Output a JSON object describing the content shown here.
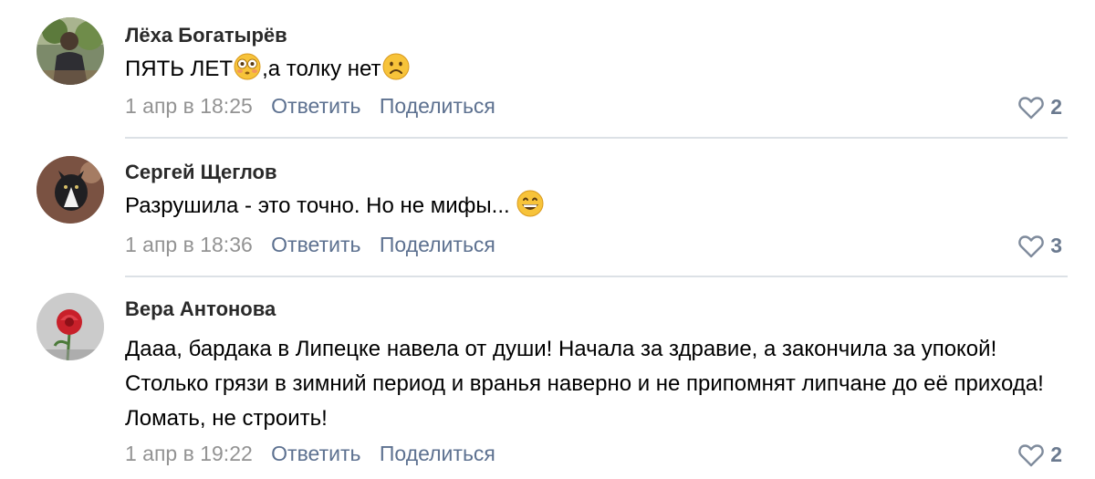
{
  "comments": [
    {
      "author": "Лёха Богатырёв",
      "text_before_emoji1": "ПЯТЬ ЛЕТ",
      "text_between": ",а толку нет",
      "emoji1": "flushed-face-emoji",
      "emoji2": "frowning-face-emoji",
      "date": "1 апр в 18:25",
      "reply_label": "Ответить",
      "share_label": "Поделиться",
      "likes": "2",
      "like_icon": "heart-icon"
    },
    {
      "author": "Сергей Щеглов",
      "text": "Разрушила - это точно. Но не мифы... ",
      "emoji1": "grinning-face-emoji",
      "date": "1 апр в 18:36",
      "reply_label": "Ответить",
      "share_label": "Поделиться",
      "likes": "3",
      "like_icon": "heart-icon"
    },
    {
      "author": "Вера Антонова",
      "text": "Дааа, бардака в Липецке навела от души! Начала за здравие, а закончила за упокой! Столько грязи в зимний период и вранья наверно и не припомнят липчане до её прихода! Ломать, не строить!",
      "date": "1 апр в 19:22",
      "reply_label": "Ответить",
      "share_label": "Поделиться",
      "likes": "2",
      "like_icon": "heart-icon"
    }
  ],
  "colors": {
    "author": "#2a2a2a",
    "meta_date": "#939393",
    "meta_action": "#5d7190",
    "likes": "#6b7a8f",
    "divider": "#dce1e6",
    "emoji_yellow": "#f7c33a"
  }
}
